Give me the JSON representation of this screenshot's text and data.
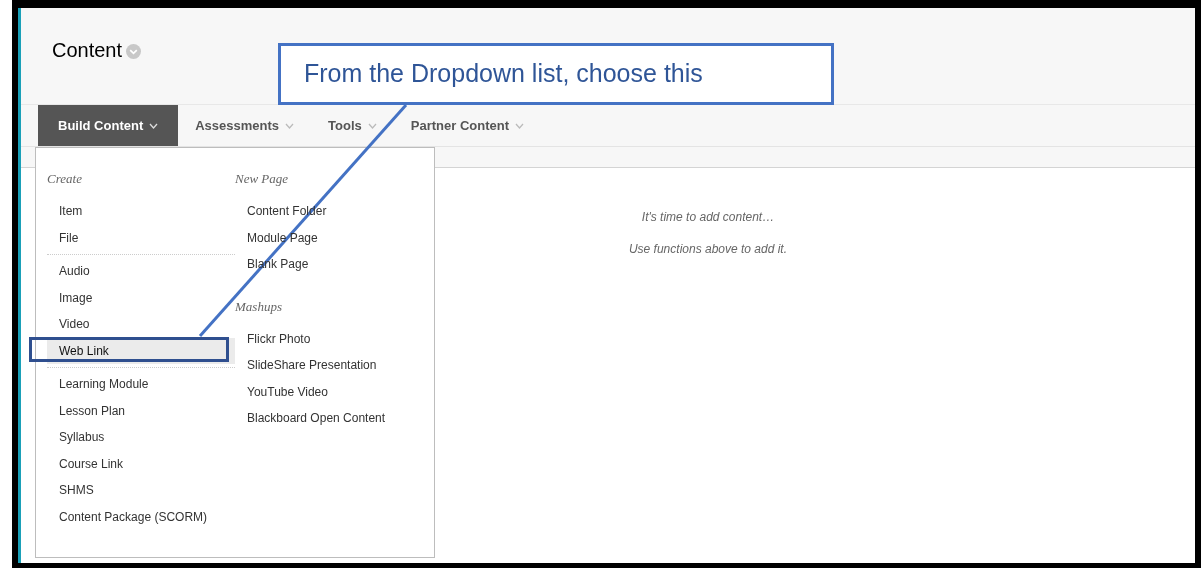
{
  "page_title": "Content",
  "tabs": [
    {
      "label": "Build Content",
      "selected": true
    },
    {
      "label": "Assessments",
      "selected": false
    },
    {
      "label": "Tools",
      "selected": false
    },
    {
      "label": "Partner Content",
      "selected": false
    }
  ],
  "dropdown": {
    "columns": [
      {
        "sections": [
          {
            "heading": "Create",
            "groups": [
              {
                "items": [
                  {
                    "label": "Item",
                    "selected": false
                  },
                  {
                    "label": "File",
                    "selected": false
                  }
                ]
              },
              {
                "items": [
                  {
                    "label": "Audio",
                    "selected": false
                  },
                  {
                    "label": "Image",
                    "selected": false
                  },
                  {
                    "label": "Video",
                    "selected": false
                  },
                  {
                    "label": "Web Link",
                    "selected": true
                  }
                ]
              },
              {
                "items": [
                  {
                    "label": "Learning Module",
                    "selected": false
                  },
                  {
                    "label": "Lesson Plan",
                    "selected": false
                  },
                  {
                    "label": "Syllabus",
                    "selected": false
                  },
                  {
                    "label": "Course Link",
                    "selected": false
                  },
                  {
                    "label": "SHMS",
                    "selected": false
                  },
                  {
                    "label": "Content Package (SCORM)",
                    "selected": false
                  }
                ]
              }
            ]
          }
        ]
      },
      {
        "sections": [
          {
            "heading": "New Page",
            "groups": [
              {
                "items": [
                  {
                    "label": "Content Folder",
                    "selected": false
                  },
                  {
                    "label": "Module Page",
                    "selected": false
                  },
                  {
                    "label": "Blank Page",
                    "selected": false
                  }
                ]
              }
            ]
          },
          {
            "heading": "Mashups",
            "groups": [
              {
                "items": [
                  {
                    "label": "Flickr Photo",
                    "selected": false
                  },
                  {
                    "label": "SlideShare Presentation",
                    "selected": false
                  },
                  {
                    "label": "YouTube Video",
                    "selected": false
                  },
                  {
                    "label": "Blackboard Open Content",
                    "selected": false
                  }
                ]
              }
            ]
          }
        ]
      }
    ]
  },
  "empty_message": [
    "It's time to add content…",
    "Use functions above to add it."
  ],
  "callout": {
    "text": "From the Dropdown list, choose this"
  }
}
